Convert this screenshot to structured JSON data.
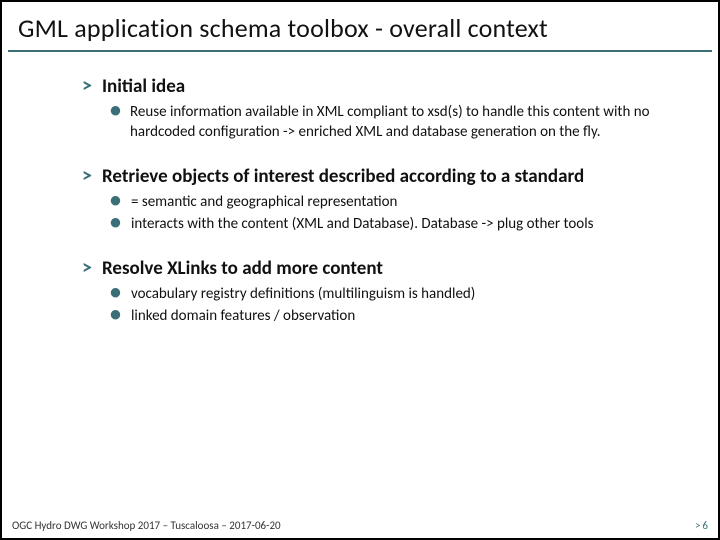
{
  "title": "GML application schema toolbox - overall context",
  "sections": [
    {
      "heading": "Initial idea",
      "bullets": [
        "Reuse information available in XML compliant to xsd(s) to handle this content with no hardcoded configuration -> enriched XML and database generation on the fly."
      ]
    },
    {
      "heading": "Retrieve objects of interest described according to a standard",
      "bullets": [
        "= semantic and geographical representation",
        "interacts with the content (XML and Database). Database -> plug other tools"
      ]
    },
    {
      "heading": "Resolve XLinks to add more content",
      "bullets": [
        "vocabulary registry definitions (multilinguism is handled)",
        "linked domain features / observation"
      ]
    }
  ],
  "footer": {
    "left": "OGC Hydro DWG Workshop 2017 –  Tuscaloosa – 2017-06-20",
    "page_prefix": ">",
    "page_number": "6"
  },
  "glyphs": {
    "gt": ">",
    "dot": "•"
  }
}
